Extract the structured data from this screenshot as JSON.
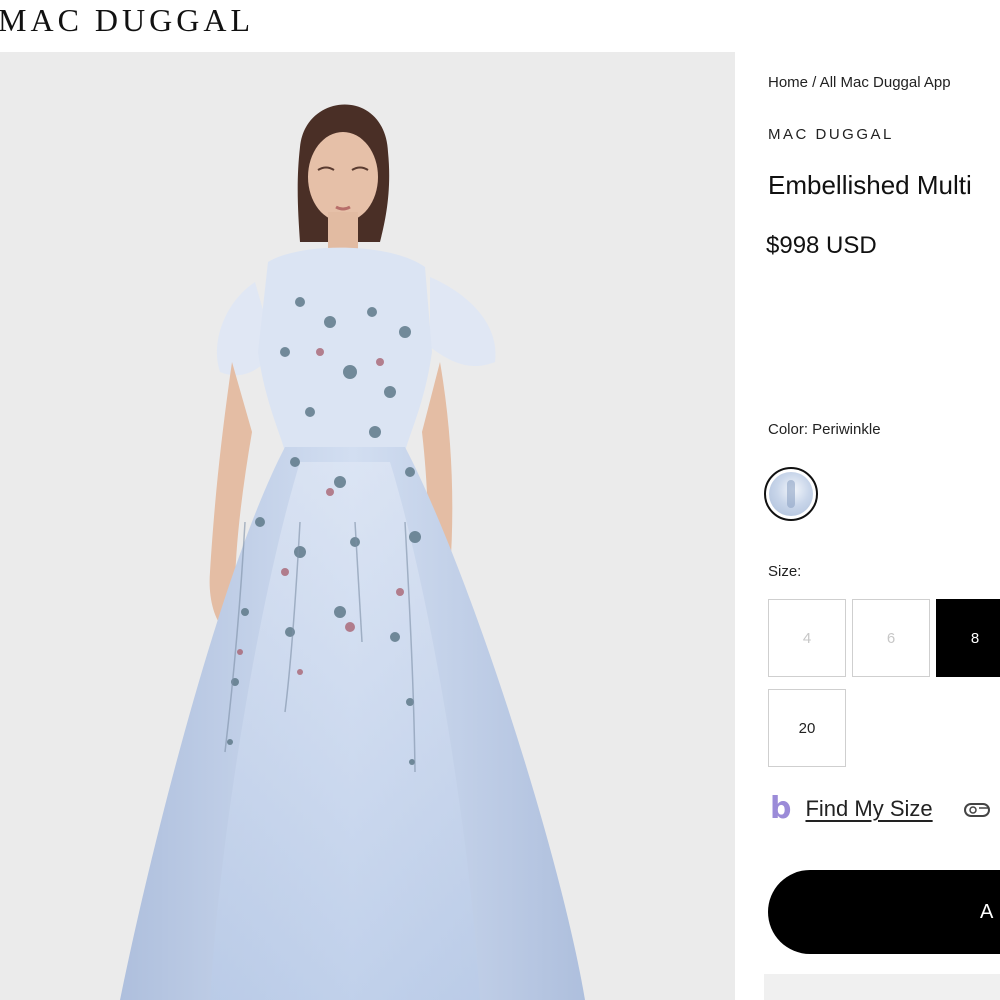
{
  "header": {
    "logo_text": "MAC DUGGAL"
  },
  "product_image": {
    "icon": "dress-photo-icon",
    "background": "#ebebeb",
    "dress_color": "#c7d6ee"
  },
  "breadcrumb": "Home / All Mac Duggal App",
  "brand": "MAC DUGGAL",
  "title": "Embellished Multi",
  "price": "$998 USD",
  "color": {
    "label": "Color: Periwinkle",
    "swatch_icon": "periwinkle-swatch-icon"
  },
  "size": {
    "label": "Size:",
    "options": [
      {
        "label": "4",
        "state": "unavailable"
      },
      {
        "label": "6",
        "state": "unavailable"
      },
      {
        "label": "8",
        "state": "selected"
      },
      {
        "label": "20",
        "state": "available"
      }
    ]
  },
  "find_my_size": {
    "icon_glyph": "b",
    "icon": "fit-assistant-icon",
    "label": "Find My Size",
    "secondary_icon": "measuring-tape-icon"
  },
  "add_to_bag": {
    "label": "A"
  },
  "colors": {
    "accent": "#000000",
    "size_border": "#cfcfcf",
    "fit_icon": "#9b8bd8"
  }
}
